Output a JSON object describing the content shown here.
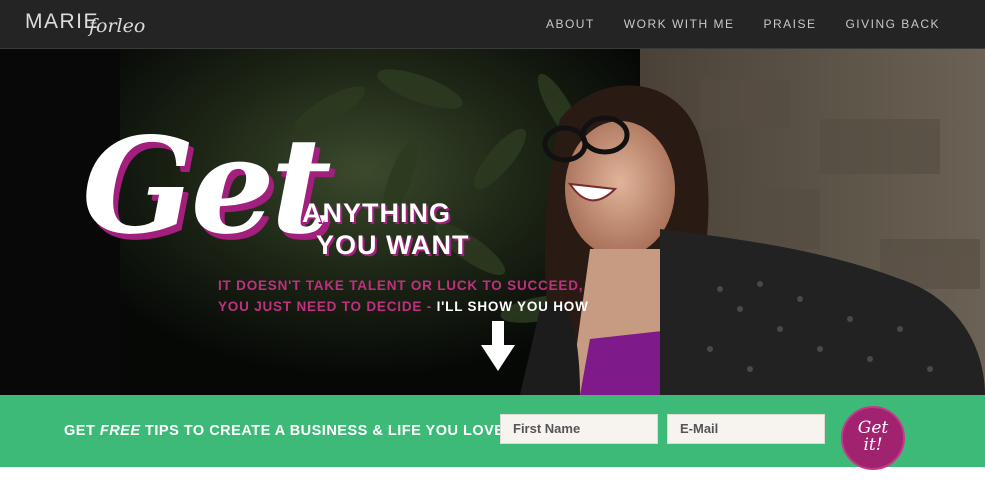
{
  "nav": {
    "logo": {
      "name": "MARIE",
      "script": "forleo"
    },
    "items": [
      "ABOUT",
      "WORK WITH ME",
      "PRAISE",
      "GIVING BACK"
    ]
  },
  "hero": {
    "big_word": "Get",
    "headline_line1": "ANYTHING",
    "headline_line2": "YOU WANT",
    "sub_line1": "IT DOESN'T TAKE TALENT OR LUCK TO SUCCEED,",
    "sub_line2_pink": "YOU JUST NEED TO DECIDE - ",
    "sub_line2_white": "I'LL SHOW YOU HOW",
    "arrow_icon": "arrow-down-icon"
  },
  "optin": {
    "text_before": "GET ",
    "text_free": "FREE",
    "text_after": " TIPS TO CREATE A BUSINESS & LIFE YOU LOVE",
    "first_name_placeholder": "First Name",
    "email_placeholder": "E-Mail",
    "submit_line1": "Get",
    "submit_line2": "it!"
  },
  "colors": {
    "nav_bg": "#242424",
    "accent_pink": "#a31f7d",
    "optin_green": "#3dba78",
    "button_purple": "#a1236f"
  }
}
